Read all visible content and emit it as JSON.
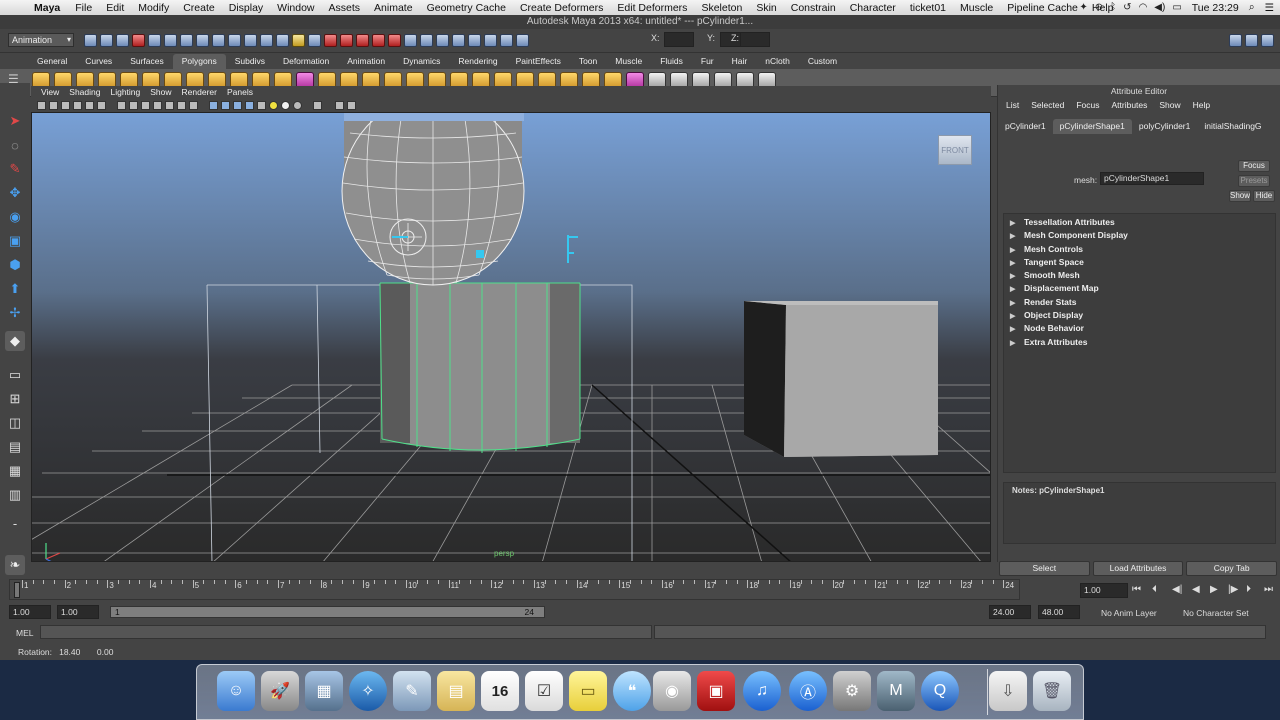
{
  "menubar": {
    "app_name": "Maya",
    "items": [
      "File",
      "Edit",
      "Modify",
      "Create",
      "Display",
      "Window",
      "Assets",
      "Animate",
      "Geometry Cache",
      "Create Deformers",
      "Edit Deformers",
      "Skeleton",
      "Skin",
      "Constrain",
      "Character",
      "ticket01",
      "Muscle",
      "Pipeline Cache",
      "Help"
    ],
    "clock": "Tue 23:29"
  },
  "window": {
    "title": "Autodesk Maya 2013 x64: untitled*  ---  pCylinder1..."
  },
  "statusline": {
    "mode": "Animation",
    "x_label": "X:",
    "y_label": "Y:",
    "z_label": "Z:"
  },
  "shelf": {
    "tabs": [
      "General",
      "Curves",
      "Surfaces",
      "Polygons",
      "Subdivs",
      "Deformation",
      "Animation",
      "Dynamics",
      "Rendering",
      "PaintEffects",
      "Toon",
      "Muscle",
      "Fluids",
      "Fur",
      "Hair",
      "nCloth",
      "Custom"
    ],
    "active_tab": "Polygons"
  },
  "viewport": {
    "menus": [
      "View",
      "Shading",
      "Lighting",
      "Show",
      "Renderer",
      "Panels"
    ],
    "viewcube_label": "FRONT",
    "camera_label": "persp"
  },
  "attribute_editor": {
    "title": "Attribute Editor",
    "menus": [
      "List",
      "Selected",
      "Focus",
      "Attributes",
      "Show",
      "Help"
    ],
    "tabs": [
      "pCylinder1",
      "pCylinderShape1",
      "polyCylinder1",
      "initialShadingG"
    ],
    "active_tab": "pCylinderShape1",
    "mesh_label": "mesh:",
    "mesh_value": "pCylinderShape1",
    "focus_button": "Focus",
    "presets_button": "Presets",
    "show_button": "Show",
    "hide_button": "Hide",
    "sections": [
      "Tessellation Attributes",
      "Mesh Component Display",
      "Mesh Controls",
      "Tangent Space",
      "Smooth Mesh",
      "Displacement Map",
      "Render Stats",
      "Object Display",
      "Node Behavior",
      "Extra Attributes"
    ],
    "notes_label": "Notes:  pCylinderShape1",
    "buttons": {
      "select": "Select",
      "load": "Load Attributes",
      "copy": "Copy Tab"
    }
  },
  "timeslider": {
    "ticks": [
      "1",
      "2",
      "3",
      "4",
      "5",
      "6",
      "7",
      "8",
      "9",
      "10",
      "11",
      "12",
      "13",
      "14",
      "15",
      "16",
      "17",
      "18",
      "19",
      "20",
      "21",
      "22",
      "23",
      "24"
    ],
    "current_frame": "1.00"
  },
  "rangeslider": {
    "start": "1.00",
    "playback_start": "1.00",
    "bar_start": "1",
    "bar_end": "24",
    "playback_end": "24.00",
    "end": "48.00",
    "anim_layer": "No Anim Layer",
    "character_set": "No Character Set"
  },
  "commandline": {
    "label": "MEL"
  },
  "helpline": {
    "text": "Rotation:   18.40       0.00"
  },
  "dock": {
    "calendar_day": "16",
    "icons": [
      "finder-icon",
      "launchpad-icon",
      "photo-browser-icon",
      "safari-icon",
      "preview-icon",
      "notes-icon",
      "calendar-icon",
      "reminders-icon",
      "stickies-icon",
      "messages-icon",
      "facetime-icon",
      "photo-booth-icon",
      "itunes-icon",
      "app-store-icon",
      "system-preferences-icon",
      "maya-icon",
      "quicktime-icon",
      "downloads-icon",
      "trash-icon"
    ]
  },
  "colors": {
    "selection_green": "#4fe08a",
    "manipulator_cyan": "#35c8f0",
    "viewport_sky": "#78a0d6"
  }
}
